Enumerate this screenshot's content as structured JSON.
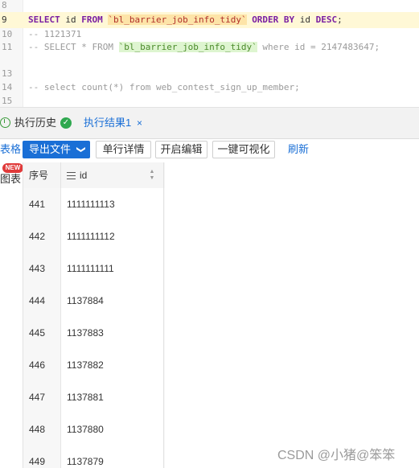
{
  "editor": {
    "lines": [
      {
        "no": "8"
      },
      {
        "no": "9",
        "kw1": "SELECT",
        "id1": " id ",
        "kw2": "FROM",
        "sp1": " ",
        "table": "`bl_barrier_job_info_tidy`",
        "sp2": " ",
        "kw3": "ORDER BY",
        "id2": " id ",
        "kw4": "DESC",
        "end": ";"
      },
      {
        "no": "10",
        "comment": "-- 1121371"
      },
      {
        "no": "11",
        "c1": "-- SELECT * FROM ",
        "table": "`bl_barrier_job_info_tidy`",
        "c2": " where id = 2147483647;"
      },
      {
        "no": "13"
      },
      {
        "no": "14",
        "comment": "-- select count(*) from web_contest_sign_up_member;"
      },
      {
        "no": "15"
      }
    ]
  },
  "tabs": {
    "history": "执行历史",
    "result": "执行结果1",
    "close": "×"
  },
  "toolbar": {
    "side_table": "表格",
    "export": "导出文件",
    "export_chevron": "❯",
    "row_detail": "单行详情",
    "open_edit": "开启编辑",
    "visualize": "一键可视化",
    "refresh": "刷新"
  },
  "side": {
    "chart": "图表",
    "new_badge": "NEW"
  },
  "grid": {
    "col_seq": "序号",
    "col_id": "id",
    "rows": [
      {
        "seq": "441",
        "id": "1111111113"
      },
      {
        "seq": "442",
        "id": "1111111112"
      },
      {
        "seq": "443",
        "id": "1111111111"
      },
      {
        "seq": "444",
        "id": "1137884"
      },
      {
        "seq": "445",
        "id": "1137883"
      },
      {
        "seq": "446",
        "id": "1137882"
      },
      {
        "seq": "447",
        "id": "1137881"
      },
      {
        "seq": "448",
        "id": "1137880"
      },
      {
        "seq": "449",
        "id": "1137879"
      }
    ]
  },
  "watermark": "CSDN @小猪@笨笨"
}
